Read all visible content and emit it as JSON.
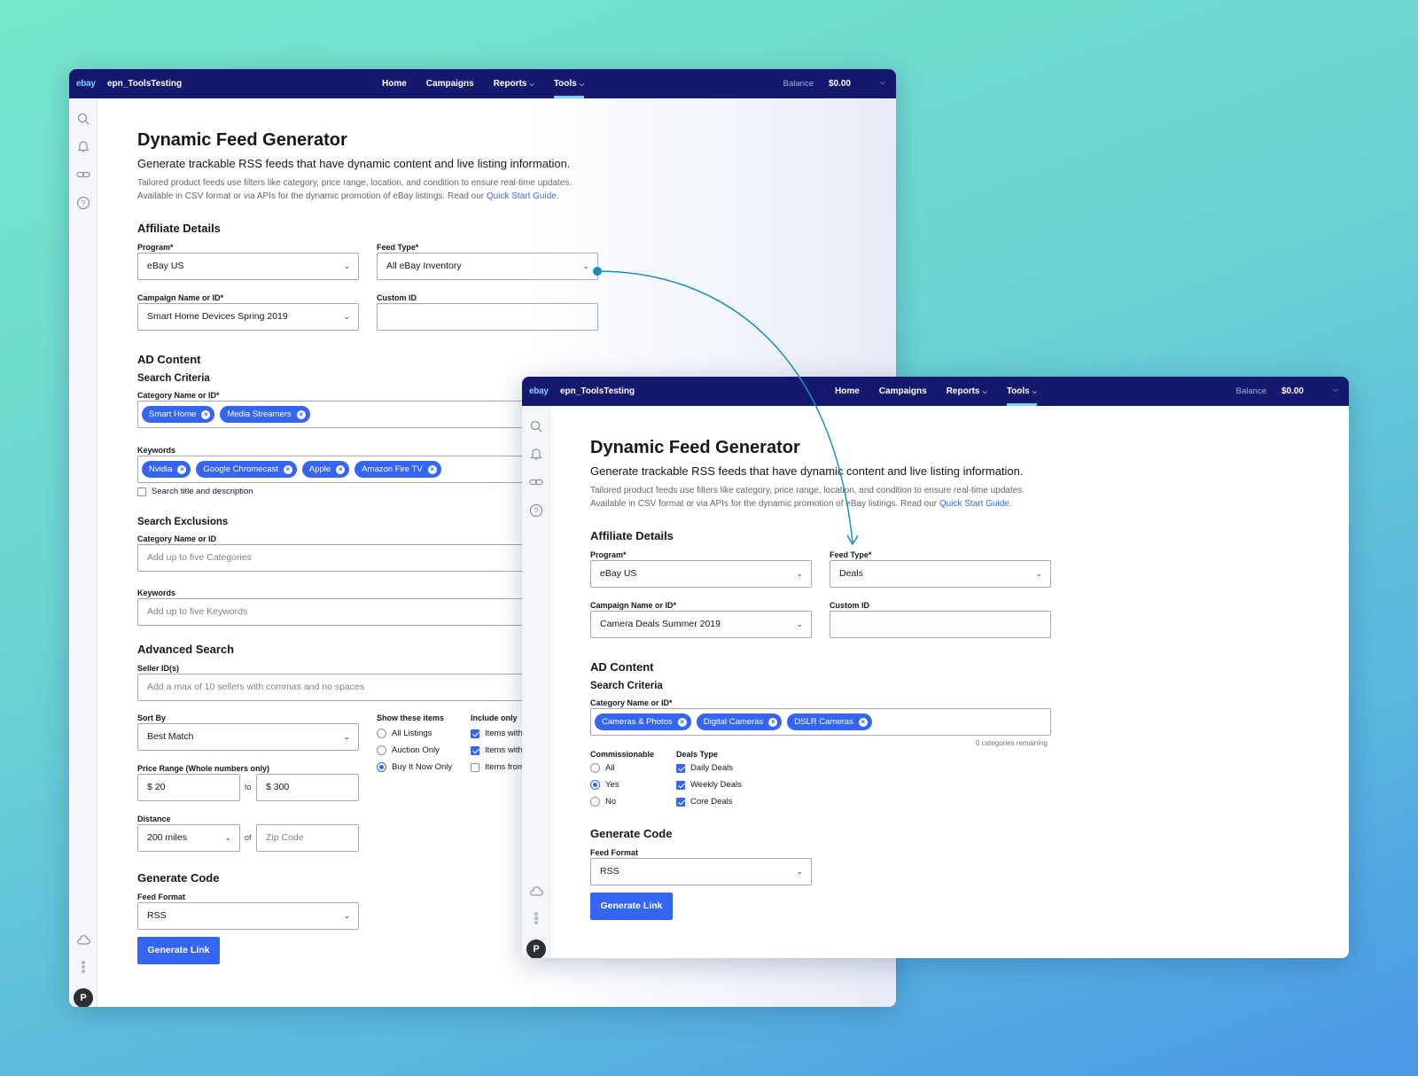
{
  "nav": {
    "logo": "ebay",
    "account": "epn_ToolsTesting",
    "items": [
      "Home",
      "Campaigns",
      "Reports",
      "Tools"
    ],
    "balance_label": "Balance",
    "balance_value": "$0.00"
  },
  "page": {
    "title": "Dynamic Feed Generator",
    "subtitle": "Generate trackable RSS feeds that have dynamic content and live listing information.",
    "desc_line1": "Tailored product feeds use filters like category, price range, location, and condition to ensure real-time updates.",
    "desc_line2": "Available in CSV format or via APIs for the dynamic promotion of eBay listings. Read our",
    "desc_link": "Quick Start Guide",
    "desc_end": "."
  },
  "labels": {
    "affiliate_details": "Affiliate Details",
    "program": "Program*",
    "feed_type": "Feed Type*",
    "campaign": "Campaign Name or ID*",
    "custom_id": "Custom ID",
    "ad_content": "AD Content",
    "search_criteria": "Search Criteria",
    "category_req": "Category Name or ID*",
    "keywords": "Keywords",
    "search_title_desc": "Search title and description",
    "search_exclusions": "Search Exclusions",
    "category_opt": "Category Name or ID",
    "advanced_search": "Advanced Search",
    "seller_ids": "Seller ID(s)",
    "sort_by": "Sort By",
    "show_items": "Show these items",
    "include_only": "Include only",
    "price_range": "Price Range (Whole numbers only)",
    "to": "to",
    "distance": "Distance",
    "of": "of",
    "generate_code": "Generate Code",
    "feed_format": "Feed Format",
    "generate_link": "Generate Link",
    "commissionable": "Commissionable",
    "deals_type": "Deals Type",
    "categories_remaining": "0 categories remaining"
  },
  "back": {
    "program": "eBay US",
    "feed_type": "All eBay Inventory",
    "campaign": "Smart Home Devices Spring 2019",
    "custom_id": "",
    "categories": [
      "Smart Home",
      "Media Streamers"
    ],
    "keywords": [
      "Nvidia",
      "Google Chromecast",
      "Apple",
      "Amazon Fire TV"
    ],
    "search_title_checked": false,
    "excl_category_placeholder": "Add up to five Categories",
    "excl_keywords_placeholder": "Add up to five Keywords",
    "seller_placeholder": "Add a max of 10 sellers with commas and no spaces",
    "sort_by": "Best Match",
    "show_items": [
      {
        "label": "All Listings",
        "selected": false
      },
      {
        "label": "Auction Only",
        "selected": false
      },
      {
        "label": "Buy It Now Only",
        "selected": true
      }
    ],
    "include_only": [
      {
        "label": "Items with",
        "checked": true
      },
      {
        "label": "Items with",
        "checked": true
      },
      {
        "label": "Items from",
        "checked": false
      }
    ],
    "price_min": "$ 20",
    "price_max": "$ 300",
    "distance": "200 miles",
    "zip_placeholder": "Zip Code",
    "feed_format": "RSS"
  },
  "front": {
    "program": "eBay US",
    "feed_type": "Deals",
    "campaign": "Camera Deals Summer 2019",
    "custom_id": "",
    "categories": [
      "Cameras & Photos",
      "Digital Cameras",
      "DSLR Cameras"
    ],
    "commissionable": [
      {
        "label": "All",
        "selected": false
      },
      {
        "label": "Yes",
        "selected": true
      },
      {
        "label": "No",
        "selected": false
      }
    ],
    "deals_type": [
      {
        "label": "Daily Deals",
        "checked": true
      },
      {
        "label": "Weekly Deals",
        "checked": true
      },
      {
        "label": "Core Deals",
        "checked": true
      }
    ],
    "feed_format": "RSS"
  },
  "colors": {
    "navbar": "#14196e",
    "accent": "#3665f3",
    "connector": "#1a8fc4",
    "background_top": "#76e6ca",
    "background_bottom": "#4a97e6"
  },
  "icons": [
    "search-icon",
    "bell-icon",
    "link-icon",
    "help-icon",
    "cloud-icon",
    "more-vertical-icon",
    "chevron-down-icon",
    "close-icon"
  ],
  "avatar_initial": "P"
}
